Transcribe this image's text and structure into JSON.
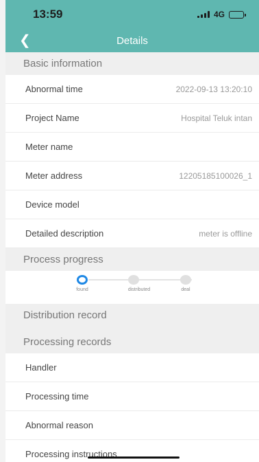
{
  "status_bar": {
    "time": "13:59",
    "network": "4G"
  },
  "nav": {
    "title": "Details",
    "back_icon": "chevron-left-icon"
  },
  "sections": {
    "basic": "Basic information",
    "progress": "Process progress",
    "distribution": "Distribution record",
    "processing": "Processing records"
  },
  "basic_rows": [
    {
      "label": "Abnormal time",
      "value": "2022-09-13 13:20:10"
    },
    {
      "label": "Project Name",
      "value": "Hospital Teluk intan"
    },
    {
      "label": "Meter name",
      "value": ""
    },
    {
      "label": "Meter address",
      "value": "12205185100026_1"
    },
    {
      "label": "Device model",
      "value": ""
    },
    {
      "label": "Detailed description",
      "value": "meter is offline"
    }
  ],
  "progress_steps": [
    {
      "label": "found",
      "active": true
    },
    {
      "label": "distributed",
      "active": false
    },
    {
      "label": "deal",
      "active": false
    }
  ],
  "processing_rows": [
    {
      "label": "Handler",
      "value": ""
    },
    {
      "label": "Processing time",
      "value": ""
    },
    {
      "label": "Abnormal reason",
      "value": ""
    },
    {
      "label": "Processing instructions",
      "value": ""
    }
  ],
  "colors": {
    "header": "#5fb7b0",
    "active_step": "#1e88e5"
  }
}
